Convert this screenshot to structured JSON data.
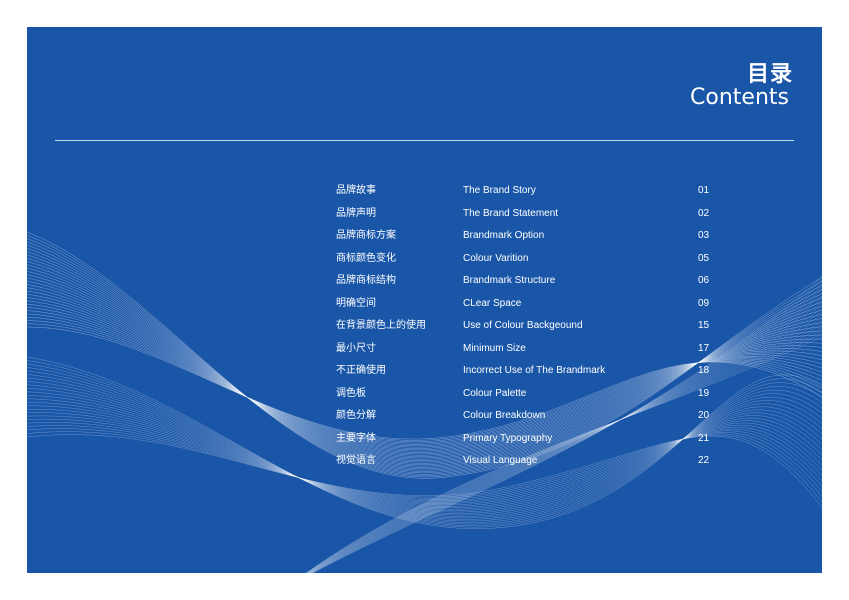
{
  "header": {
    "title_cn": "目录",
    "title_en": "Contents"
  },
  "toc": [
    {
      "cn": "品牌故事",
      "en": "The Brand Story",
      "page": "01"
    },
    {
      "cn": "品牌声明",
      "en": "The Brand Statement",
      "page": "02"
    },
    {
      "cn": "品牌商标方案",
      "en": "Brandmark Option",
      "page": "03"
    },
    {
      "cn": "商标颜色变化",
      "en": "Colour Varition",
      "page": "05"
    },
    {
      "cn": "品牌商标结构",
      "en": "Brandmark Structure",
      "page": "06"
    },
    {
      "cn": "明确空间",
      "en": "CLear Space",
      "page": "09"
    },
    {
      "cn": "在背景颜色上的使用",
      "en": "Use of Colour Backgeound",
      "page": "15"
    },
    {
      "cn": "最小尺寸",
      "en": "Minimum Size",
      "page": "17"
    },
    {
      "cn": "不正确使用",
      "en": "Incorrect Use of The Brandmark",
      "page": "18"
    },
    {
      "cn": "调色板",
      "en": "Colour Palette",
      "page": "19"
    },
    {
      "cn": "颜色分解",
      "en": "Colour Breakdown",
      "page": "20"
    },
    {
      "cn": "主要字体",
      "en": "Primary Typography",
      "page": "21"
    },
    {
      "cn": "视觉语言",
      "en": "Visual Language",
      "page": "22"
    }
  ],
  "colors": {
    "background": "#1a56a8",
    "text": "#ffffff"
  }
}
